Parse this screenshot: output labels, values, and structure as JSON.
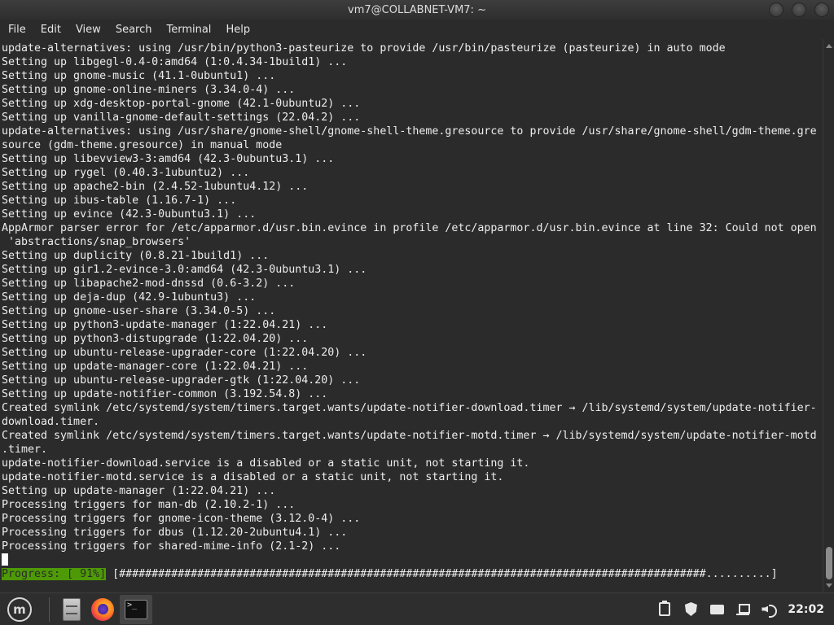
{
  "window": {
    "title": "vm7@COLLABNET-VM7: ~"
  },
  "menubar": {
    "items": [
      "File",
      "Edit",
      "View",
      "Search",
      "Terminal",
      "Help"
    ]
  },
  "terminal": {
    "lines": [
      "update-alternatives: using /usr/bin/python3-pasteurize to provide /usr/bin/pasteurize (pasteurize) in auto mode",
      "Setting up libgegl-0.4-0:amd64 (1:0.4.34-1build1) ...",
      "Setting up gnome-music (41.1-0ubuntu1) ...",
      "Setting up gnome-online-miners (3.34.0-4) ...",
      "Setting up xdg-desktop-portal-gnome (42.1-0ubuntu2) ...",
      "Setting up vanilla-gnome-default-settings (22.04.2) ...",
      "update-alternatives: using /usr/share/gnome-shell/gnome-shell-theme.gresource to provide /usr/share/gnome-shell/gdm-theme.gre",
      "source (gdm-theme.gresource) in manual mode",
      "Setting up libevview3-3:amd64 (42.3-0ubuntu3.1) ...",
      "Setting up rygel (0.40.3-1ubuntu2) ...",
      "Setting up apache2-bin (2.4.52-1ubuntu4.12) ...",
      "Setting up ibus-table (1.16.7-1) ...",
      "Setting up evince (42.3-0ubuntu3.1) ...",
      "AppArmor parser error for /etc/apparmor.d/usr.bin.evince in profile /etc/apparmor.d/usr.bin.evince at line 32: Could not open",
      " 'abstractions/snap_browsers'",
      "Setting up duplicity (0.8.21-1build1) ...",
      "Setting up gir1.2-evince-3.0:amd64 (42.3-0ubuntu3.1) ...",
      "Setting up libapache2-mod-dnssd (0.6-3.2) ...",
      "Setting up deja-dup (42.9-1ubuntu3) ...",
      "Setting up gnome-user-share (3.34.0-5) ...",
      "Setting up python3-update-manager (1:22.04.21) ...",
      "Setting up python3-distupgrade (1:22.04.20) ...",
      "Setting up ubuntu-release-upgrader-core (1:22.04.20) ...",
      "Setting up update-manager-core (1:22.04.21) ...",
      "Setting up ubuntu-release-upgrader-gtk (1:22.04.20) ...",
      "Setting up update-notifier-common (3.192.54.8) ...",
      "Created symlink /etc/systemd/system/timers.target.wants/update-notifier-download.timer → /lib/systemd/system/update-notifier-",
      "download.timer.",
      "Created symlink /etc/systemd/system/timers.target.wants/update-notifier-motd.timer → /lib/systemd/system/update-notifier-motd",
      ".timer.",
      "update-notifier-download.service is a disabled or a static unit, not starting it.",
      "update-notifier-motd.service is a disabled or a static unit, not starting it.",
      "Setting up update-manager (1:22.04.21) ...",
      "Processing triggers for man-db (2.10.2-1) ...",
      "Processing triggers for gnome-icon-theme (3.12.0-4) ...",
      "Processing triggers for dbus (1.12.20-2ubuntu4.1) ...",
      "Processing triggers for shared-mime-info (2.1-2) ..."
    ],
    "progress": {
      "label": "Progress: [ 91%]",
      "bar": " [##########################################################################################..........]",
      "fraction": 0.91
    }
  },
  "taskbar": {
    "menu_icon": "linux-mint-logo-icon",
    "menu_glyph": "m",
    "launchers": [
      "file-manager-icon",
      "firefox-icon",
      "terminal-icon"
    ],
    "terminal_glyph": ">_",
    "tray": [
      "clipboard-icon",
      "shield-update-icon",
      "keyboard-icon",
      "network-icon",
      "volume-icon"
    ],
    "clock": "22:02"
  },
  "colors": {
    "terminal_bg": "#2b2b2b",
    "terminal_fg": "#ededed",
    "progress_bg": "#4e9a06"
  }
}
